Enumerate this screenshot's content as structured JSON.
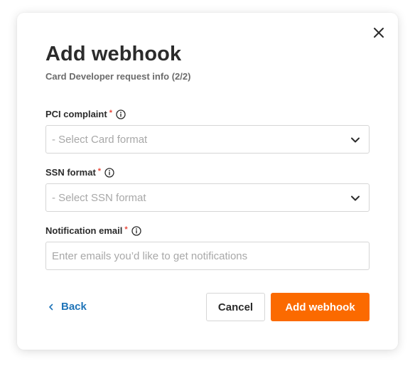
{
  "dialog": {
    "title": "Add webhook",
    "subtitle": "Card Developer request info (2/2)",
    "close_icon": "close-icon"
  },
  "fields": {
    "pci": {
      "label": "PCI complaint",
      "required_mark": "*",
      "placeholder": "- Select Card format"
    },
    "ssn": {
      "label": "SSN format",
      "required_mark": "*",
      "placeholder": "- Select SSN format"
    },
    "email": {
      "label": "Notification email",
      "required_mark": "*",
      "placeholder": "Enter emails you’d like to get notifications"
    }
  },
  "footer": {
    "back_label": "Back",
    "cancel_label": "Cancel",
    "submit_label": "Add webhook"
  },
  "colors": {
    "accent": "#fb6a00",
    "link": "#1f74b8",
    "required": "#e8483b"
  }
}
